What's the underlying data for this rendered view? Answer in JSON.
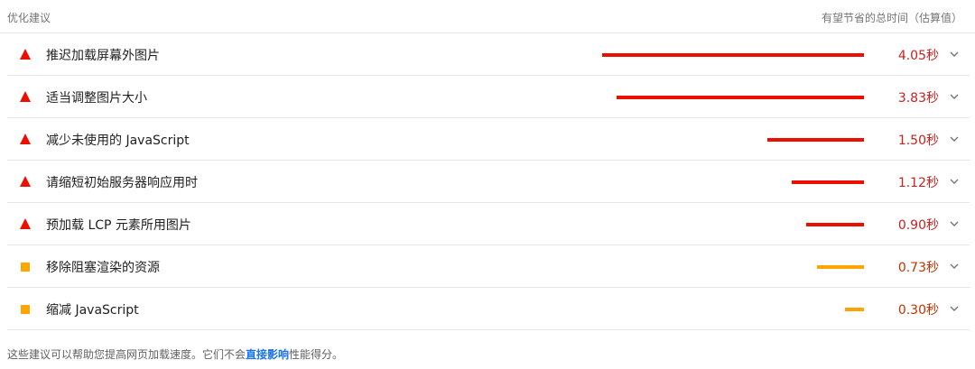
{
  "header": {
    "left_title": "优化建议",
    "right_title": "有望节省的总时间（估算值）"
  },
  "rows": [
    {
      "label": "推迟加载屏幕外图片",
      "value": "4.05秒",
      "seconds": 4.05,
      "rating": "fail"
    },
    {
      "label": "适当调整图片大小",
      "value": "3.83秒",
      "seconds": 3.83,
      "rating": "fail"
    },
    {
      "label": "减少未使用的 JavaScript",
      "value": "1.50秒",
      "seconds": 1.5,
      "rating": "fail"
    },
    {
      "label": "请缩短初始服务器响应用时",
      "value": "1.12秒",
      "seconds": 1.12,
      "rating": "fail"
    },
    {
      "label": "预加载 LCP 元素所用图片",
      "value": "0.90秒",
      "seconds": 0.9,
      "rating": "fail"
    },
    {
      "label": "移除阻塞渲染的资源",
      "value": "0.73秒",
      "seconds": 0.73,
      "rating": "average"
    },
    {
      "label": "缩减 JavaScript",
      "value": "0.30秒",
      "seconds": 0.3,
      "rating": "average"
    }
  ],
  "colors": {
    "fail": "#eb0f00",
    "average": "#ffa400",
    "link": "#1a73e8"
  },
  "footer": {
    "text_before": "这些建议可以帮助您提高网页加载速度。它们不会",
    "link": "直接影响",
    "text_after": "性能得分。"
  }
}
